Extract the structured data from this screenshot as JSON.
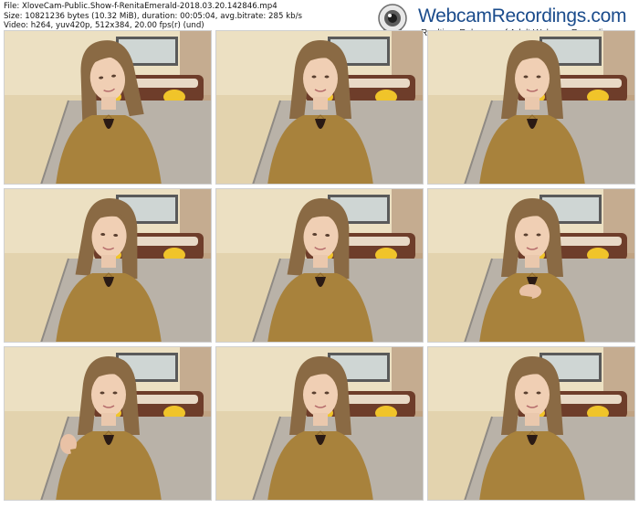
{
  "header": {
    "file_line": "File: XloveCam-Public.Show-f-RenitaEmerald-2018.03.20.142846.mp4",
    "size_line": "Size: 10821236 bytes (10.32 MiB), duration: 00:05:04, avg.bitrate: 285 kb/s",
    "video_line": "Video: h264, yuv420p, 512x384, 20.00 fps(r) (und)"
  },
  "logo": {
    "title": "WebcamRecordings.com",
    "subtitle": "Realtime Releases of Adult Webcam Recordings",
    "icon": "webcam-icon"
  },
  "thumbnails": [
    {
      "pose": "head-tilt"
    },
    {
      "pose": "smile"
    },
    {
      "pose": "neutral"
    },
    {
      "pose": "look-down"
    },
    {
      "pose": "look-down"
    },
    {
      "pose": "hand-chin"
    },
    {
      "pose": "wave"
    },
    {
      "pose": "neutral"
    },
    {
      "pose": "neutral"
    }
  ],
  "colors": {
    "wall": "#e3d3ae",
    "sweater": "#a8823c",
    "hair": "#8a6a44",
    "bed": "#b9b2a8",
    "headboard": "#6e3d2a",
    "pillow": "#f0c42a",
    "logo_blue": "#1b4c8c"
  }
}
